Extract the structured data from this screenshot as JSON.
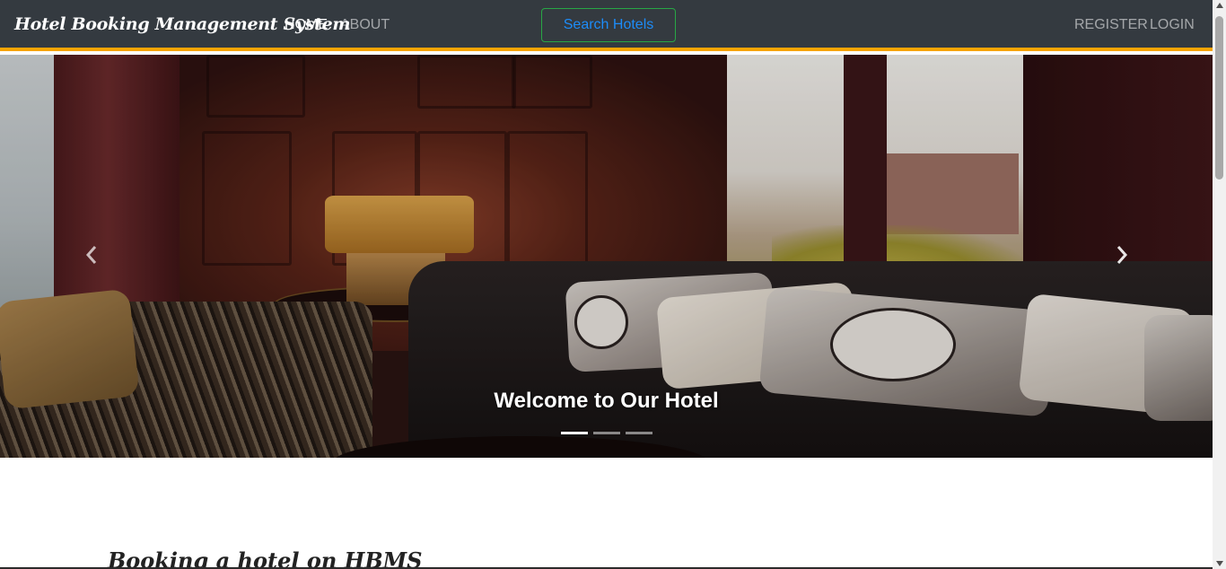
{
  "navbar": {
    "brand": "Hotel Booking Management System",
    "links": [
      {
        "label": "HOME",
        "active": true
      },
      {
        "label": "ABOUT",
        "active": false
      }
    ],
    "search_button": "Search Hotels",
    "right_links": [
      {
        "label": "REGISTER"
      },
      {
        "label": "LOGIN"
      }
    ],
    "accent_color": "#f7a400"
  },
  "carousel": {
    "caption": "Welcome to Our Hotel",
    "prev_icon": "chevron-left-icon",
    "next_icon": "chevron-right-icon",
    "slide_count": 3,
    "active_slide": 1
  },
  "main": {
    "section_title": "Booking a hotel on HBMS"
  }
}
